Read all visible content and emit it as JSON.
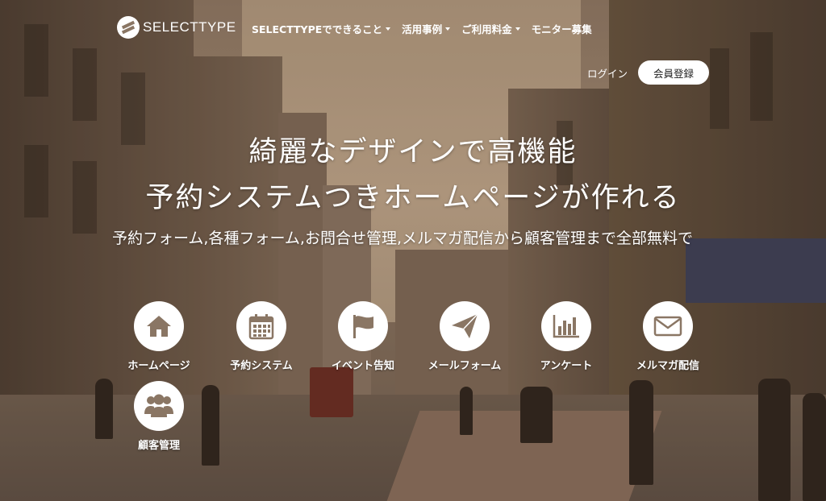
{
  "header": {
    "logo_text": "SELECTTYPE",
    "nav": [
      {
        "label": "SELECTTYPEでできること",
        "has_dropdown": true
      },
      {
        "label": "活用事例",
        "has_dropdown": true
      },
      {
        "label": "ご利用料金",
        "has_dropdown": true
      },
      {
        "label": "モニター募集",
        "has_dropdown": false
      }
    ],
    "login_label": "ログイン",
    "register_label": "会員登録"
  },
  "hero": {
    "title_line1": "綺麗なデザインで高機能",
    "title_line2": "予約システムつきホームページが作れる",
    "subtitle": "予約フォーム,各種フォーム,お問合せ管理,メルマガ配信から顧客管理まで全部無料で"
  },
  "features": [
    {
      "label": "ホームページ",
      "icon": "home-icon"
    },
    {
      "label": "予約システム",
      "icon": "calendar-icon"
    },
    {
      "label": "イベント告知",
      "icon": "flag-icon"
    },
    {
      "label": "メールフォーム",
      "icon": "paper-plane-icon"
    },
    {
      "label": "アンケート",
      "icon": "bar-chart-icon"
    },
    {
      "label": "メルマガ配信",
      "icon": "envelope-icon"
    },
    {
      "label": "顧客管理",
      "icon": "users-icon"
    }
  ],
  "colors": {
    "icon_color": "#8a7664",
    "circle_bg": "#ffffff",
    "text": "#ffffff"
  }
}
